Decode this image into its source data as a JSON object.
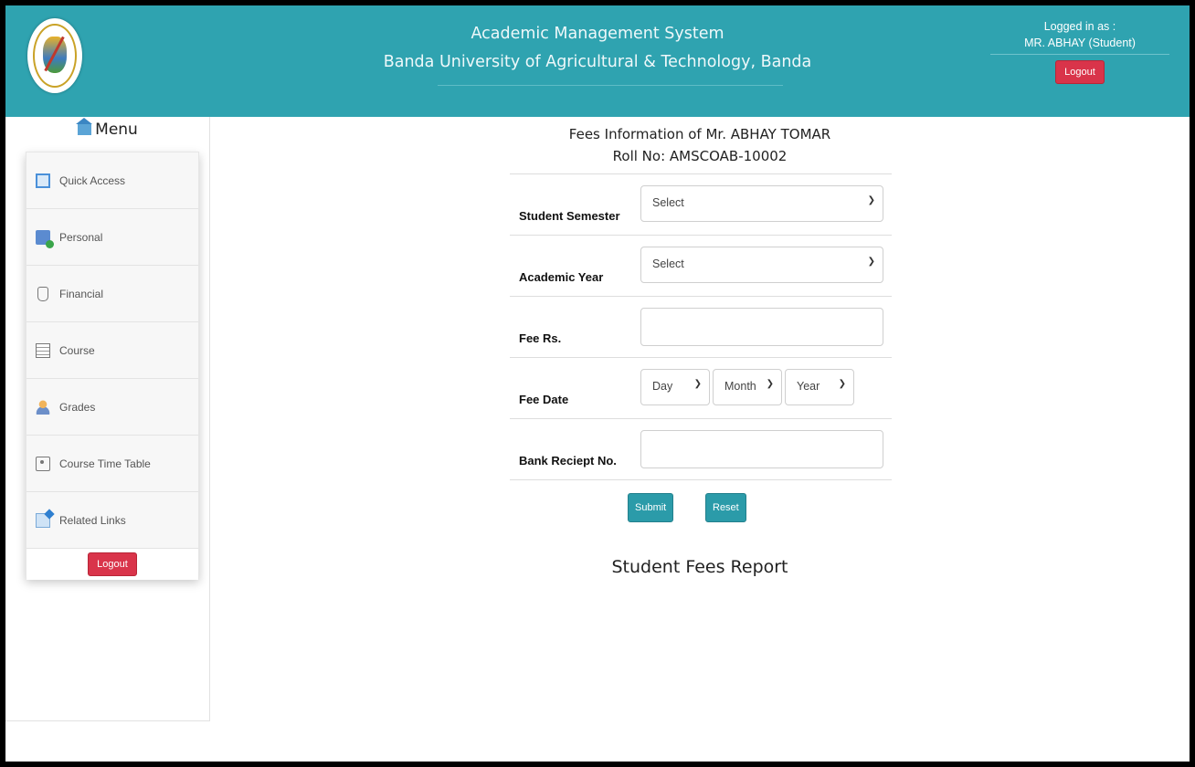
{
  "header": {
    "title_line1": "Academic Management System",
    "title_line2": "Banda University of Agricultural & Technology, Banda",
    "logged_in_label": "Logged in as :",
    "user": "MR. ABHAY (Student)",
    "logout_label": "Logout"
  },
  "sidebar": {
    "menu_title": "Menu",
    "items": [
      {
        "label": "Quick Access",
        "icon": "quick-access-icon"
      },
      {
        "label": "Personal",
        "icon": "personal-icon"
      },
      {
        "label": "Financial",
        "icon": "financial-icon"
      },
      {
        "label": "Course",
        "icon": "course-icon"
      },
      {
        "label": "Grades",
        "icon": "grades-icon"
      },
      {
        "label": "Course Time Table",
        "icon": "timetable-icon"
      },
      {
        "label": "Related Links",
        "icon": "related-links-icon"
      }
    ],
    "logout_label": "Logout"
  },
  "main": {
    "fees_title": "Fees Information of Mr. ABHAY TOMAR",
    "roll_no": "Roll No: AMSCOAB-10002",
    "form": {
      "semester_label": "Student Semester",
      "semester_value": "Select",
      "year_label": "Academic Year",
      "year_value": "Select",
      "fee_label": "Fee Rs.",
      "fee_value": "",
      "date_label": "Fee Date",
      "day_value": "Day",
      "month_value": "Month",
      "yearsel_value": "Year",
      "receipt_label": "Bank Reciept No.",
      "receipt_value": ""
    },
    "submit_label": "Submit",
    "reset_label": "Reset",
    "report_title": "Student Fees Report"
  },
  "colors": {
    "header_bg": "#2fa3b0",
    "logout_red": "#d9344a",
    "button_teal": "#2b9ba9"
  }
}
